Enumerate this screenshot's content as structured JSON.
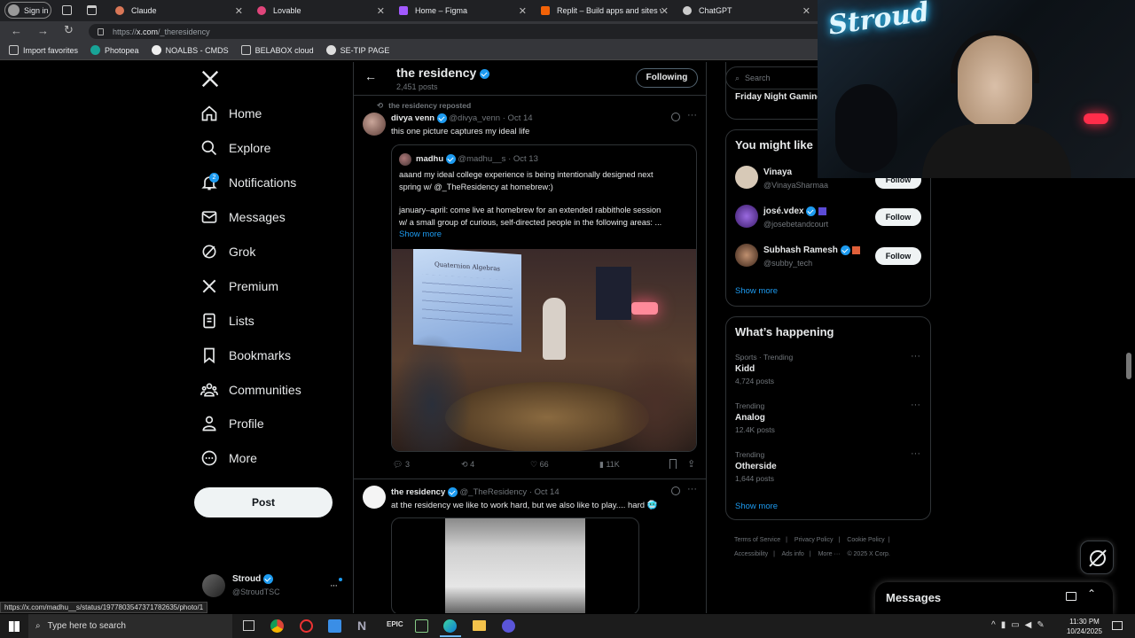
{
  "browser": {
    "sign_in": "Sign in",
    "tabs": [
      {
        "title": "Claude",
        "color": "#d97757"
      },
      {
        "title": "Lovable",
        "color": "#e0457b"
      },
      {
        "title": "Home – Figma",
        "color": "#a259ff"
      },
      {
        "title": "Replit – Build apps and sites with",
        "color": "#f26207"
      },
      {
        "title": "ChatGPT",
        "color": "#cccccc"
      }
    ],
    "url_prefix": "https://",
    "url_host": "x.com",
    "url_path": "/_theresidency",
    "bookmarks": [
      "Import favorites",
      "Photopea",
      "NOALBS - CMDS",
      "BELABOX cloud",
      "SE-TIP PAGE"
    ]
  },
  "nav": {
    "items": [
      "Home",
      "Explore",
      "Notifications",
      "Messages",
      "Grok",
      "Premium",
      "Lists",
      "Bookmarks",
      "Communities",
      "Profile",
      "More"
    ],
    "notif_badge": "2",
    "post_button": "Post",
    "account_name": "Stroud",
    "account_handle": "@StroudTSC"
  },
  "header": {
    "title": "the residency",
    "posts_count": "2,451 posts",
    "following_button": "Following"
  },
  "post1": {
    "repost_label": "the residency reposted",
    "author": "divya venn",
    "handle": "@divya_venn",
    "date": "· Oct 14",
    "text": "this one picture captures my ideal life",
    "quote_author": "madhu",
    "quote_handle": "@madhu__s",
    "quote_date": "· Oct 13",
    "quote_line1": "aaand my ideal college experience is being intentionally designed next",
    "quote_line2": "spring w/ @_TheResidency at homebrew:)",
    "quote_line3": "january–april: come live at homebrew for an extended rabbithole session",
    "quote_line4": "w/ a small group of curious, self-directed people in the following areas: ...",
    "show_more": "Show more",
    "slide_title": "Quaternion Algebras",
    "replies": "3",
    "reposts": "4",
    "likes": "66",
    "views": "11K"
  },
  "post2": {
    "author": "the residency",
    "handle": "@_TheResidency",
    "date": "· Oct 14",
    "text": "at the residency we like to work hard, but we also like to play.... hard 🥶"
  },
  "right": {
    "search_placeholder": "Search",
    "friday_partial": "Friday Night Gaming",
    "might_like_title": "You might like",
    "suggestions": [
      {
        "name": "Vinaya",
        "handle": "@VinayaSharmaa",
        "btn": "Follow"
      },
      {
        "name": "josé.vdex",
        "handle": "@josebetandcourt",
        "btn": "Follow"
      },
      {
        "name": "Subhash Ramesh",
        "handle": "@subby_tech",
        "btn": "Follow"
      }
    ],
    "show_more": "Show more",
    "happening_title": "What’s happening",
    "trends": [
      {
        "context": "Sports · Trending",
        "name": "Kidd",
        "posts": "4,724 posts"
      },
      {
        "context": "Trending",
        "name": "Analog",
        "posts": "12.4K posts"
      },
      {
        "context": "Trending",
        "name": "Otherside",
        "posts": "1,644 posts"
      }
    ],
    "show_more2": "Show more",
    "footer_links": [
      "Terms of Service",
      "Privacy Policy",
      "Cookie Policy",
      "Accessibility",
      "Ads info",
      "More ···",
      "© 2025 X Corp."
    ],
    "messages_title": "Messages"
  },
  "webcam": {
    "sign_text": "Stroud"
  },
  "statusbar": {
    "url": "https://x.com/madhu__s/status/1977803547371782635/photo/1"
  },
  "taskbar": {
    "search_placeholder": "Type here to search",
    "time": "11:30 PM",
    "date": "10/24/2025"
  }
}
